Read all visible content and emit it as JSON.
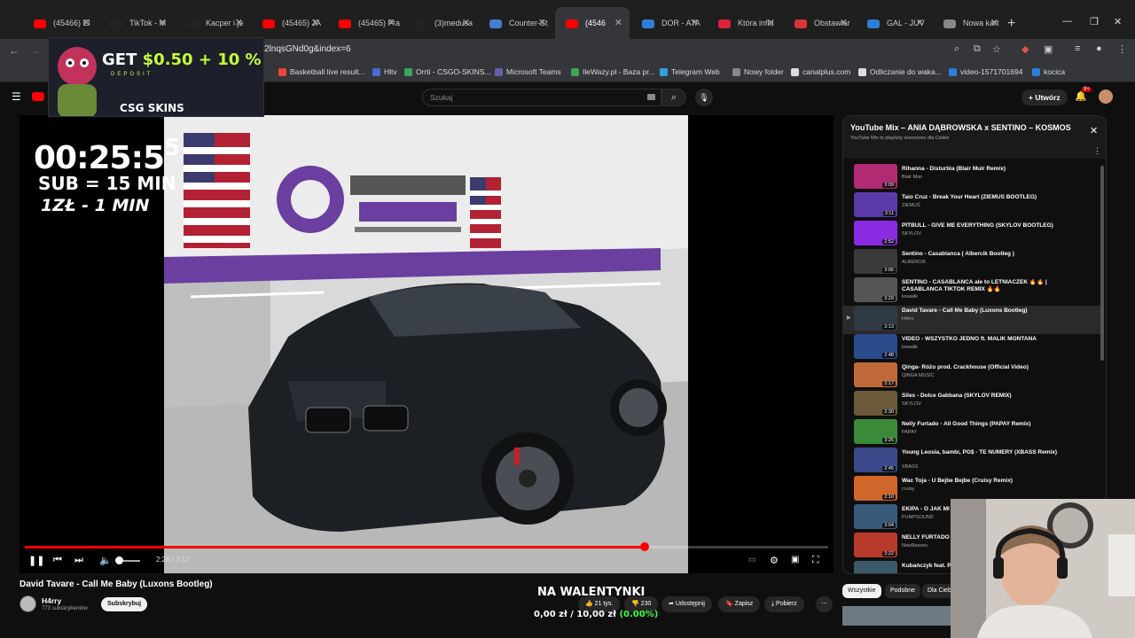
{
  "tabs": [
    {
      "label": "(45466) El",
      "color": "#ff0000"
    },
    {
      "label": "TikTok - M",
      "color": "#222222"
    },
    {
      "label": "Kacper i je",
      "color": "#222222"
    },
    {
      "label": "(45465) JA",
      "color": "#ff0000"
    },
    {
      "label": "(45465) Fra",
      "color": "#ff0000"
    },
    {
      "label": "(3)medusa",
      "color": "#222222"
    },
    {
      "label": "Counter-St",
      "color": "#4a7bd0"
    },
    {
      "label": "(4546",
      "color": "#ff0000",
      "active": true
    },
    {
      "label": "DOR - ATA",
      "color": "#2c7fd9"
    },
    {
      "label": "Która influ",
      "color": "#e0203a"
    },
    {
      "label": "Obstawiar",
      "color": "#d83636"
    },
    {
      "label": "GAL - JUV",
      "color": "#2c7fd9"
    },
    {
      "label": "Nowa kart",
      "color": "#888888"
    }
  ],
  "address_bar": {
    "url": "2lnqsGNd0g&index=6"
  },
  "bookmarks": [
    {
      "label": "Basketball live result...",
      "color": "#e8453c"
    },
    {
      "label": "Hltv",
      "color": "#4a6bd0"
    },
    {
      "label": "Orrti - CSGO-SKINS...",
      "color": "#3ba55c"
    },
    {
      "label": "Microsoft Teams",
      "color": "#6264a7"
    },
    {
      "label": "IleWazy.pl - Baza pr...",
      "color": "#3ba55c"
    },
    {
      "label": "Telegram Web",
      "color": "#2aa3e0"
    },
    {
      "label": "Nowy folder",
      "color": "#888888"
    },
    {
      "label": "canalplus.com",
      "color": "#dddddd"
    },
    {
      "label": "Odliczanie do waka...",
      "color": "#dddddd"
    },
    {
      "label": "video-1571701694",
      "color": "#2c7fd9"
    },
    {
      "label": "kocica",
      "color": "#2c7fd9"
    }
  ],
  "masthead": {
    "search_placeholder": "Szukaj",
    "create_label": "Utwórz",
    "notifications_badge": "9+"
  },
  "ad": {
    "get": "GET",
    "amount": "$0.50",
    "plus": "+ 10 %",
    "deposit": "DEPOSIT",
    "brand": "CSG SKINS"
  },
  "overlay": {
    "timer": "00:25:5",
    "timer_sup": "5",
    "line2": "SUB = 15 MIN",
    "line3": "1ZŁ - 1 MIN"
  },
  "player": {
    "time": "2:28 / 3:12",
    "progress": 0.771,
    "volume": 0.4
  },
  "video": {
    "title": "David Tavare - Call Me Baby (Luxons Bootleg)",
    "channel": "H4rry",
    "subscribers": "773 subskrybentów",
    "subscribe_label": "Subskrybuj",
    "likes": "21 tys.",
    "dislikes": "230",
    "share_label": "Udostępnij",
    "save_label": "Zapisz",
    "download_label": "Pobierz"
  },
  "donation": {
    "title": "NA WALENTYNKI",
    "current": "0,00 zł",
    "separator": "/",
    "goal": "10,00 zł",
    "percent": "(0.00%)"
  },
  "playlist": {
    "title": "YouTube Mix – ANIA DĄBROWSKA x SENTINO – KOSMOS",
    "subtitle": "YouTube Mix to playlisty stworzone dla Ciebie",
    "items": [
      {
        "title": "Rihanna - Disturbia (Blair Muir Remix)",
        "author": "Blair Muir",
        "duration": "3:09",
        "color": "#b02a74"
      },
      {
        "title": "Taio Cruz - Break Your Heart (ZIEMUŚ BOOTLEG)",
        "author": "ZIEMUŚ",
        "duration": "3:11",
        "color": "#5a3aa8"
      },
      {
        "title": "PITBULL - GIVE ME EVERYTHING (SKYLOV BOOTLEG)",
        "author": "SKYLOV",
        "duration": "2:52",
        "color": "#8a2be2"
      },
      {
        "title": "Sentino - Casablanca ( Albercik Bootleg )",
        "author": "ALBERCIK",
        "duration": "3:06",
        "color": "#3a3a3a"
      },
      {
        "title": "SENTINO - CASABLANCA ale to LETNIACZEK 🔥🔥 | CASABLANCA TIKTOK REMIX 🔥🔥",
        "author": "kowalik",
        "duration": "3:29",
        "color": "#555555"
      },
      {
        "title": "David Tavare - Call Me Baby (Luxons Bootleg)",
        "author": "H4rry",
        "duration": "3:13",
        "color": "#2f3a44",
        "current": true
      },
      {
        "title": "VIDEO - WSZYSTKO JEDNO ft. MALIK MONTANA",
        "author": "kowalik",
        "duration": "2:48",
        "color": "#2a4a8a"
      },
      {
        "title": "Qinga- Różo prod. Crackhouse (Official Video)",
        "author": "QINGA MUSIC",
        "duration": "2:17",
        "color": "#c06a3a"
      },
      {
        "title": "Siles - Dolce Gabbana (SKYLOV REMIX)",
        "author": "SKYLOV",
        "duration": "2:30",
        "color": "#6a5a3a"
      },
      {
        "title": "Nelly Furtado - All Good Things (PAPAY Remix)",
        "author": "PAPAY",
        "duration": "3:25",
        "color": "#3a8a3a"
      },
      {
        "title": "Young Leosia, bambi, PG$ - TE NUMERY (XBASS Remix)",
        "author": "XBASS",
        "duration": "2:45",
        "color": "#3a4a8a"
      },
      {
        "title": "Wac Toja - U Bejbe Bejbe (Cruisy Remix)",
        "author": "cruisy",
        "duration": "2:10",
        "color": "#d0662a"
      },
      {
        "title": "EKIPA - O JAK MI",
        "author": "PUMPSOUND",
        "duration": "3:04",
        "color": "#3a5a7a"
      },
      {
        "title": "NELLY FURTADO -",
        "author": "NoizBasses",
        "duration": "3:22",
        "color": "#b83a2a"
      },
      {
        "title": "Kubańczyk feat. P",
        "author": "",
        "duration": "",
        "color": "#3a5a6a"
      }
    ]
  },
  "chips": [
    "Wszystkie",
    "Podobne",
    "Dla Ciebie"
  ]
}
